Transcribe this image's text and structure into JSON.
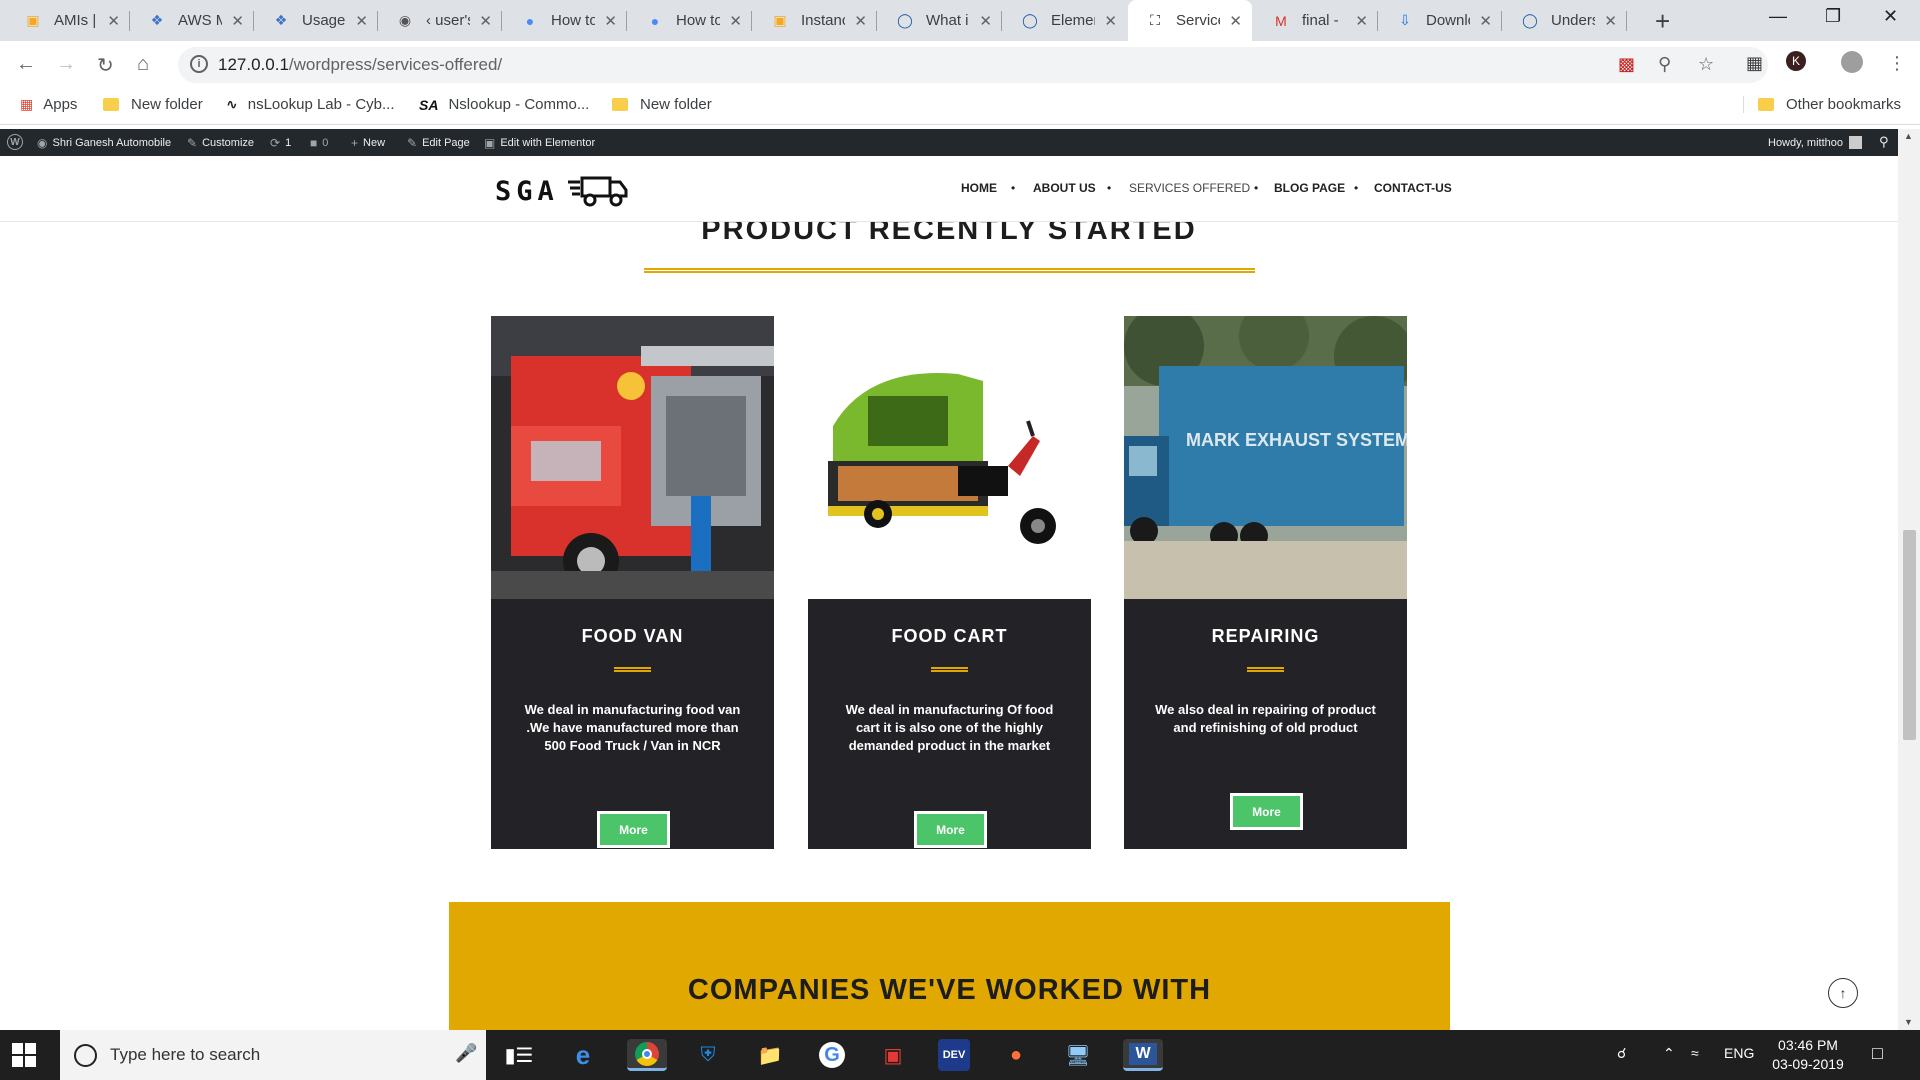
{
  "browser": {
    "tabs": [
      {
        "title": "AMIs |",
        "icon": "aws-icon",
        "color": "#f7a81b"
      },
      {
        "title": "AWS M",
        "icon": "aws-cubes-icon",
        "color": "#3b73c8"
      },
      {
        "title": "Usage",
        "icon": "aws-cubes-icon",
        "color": "#3b73c8"
      },
      {
        "title": "‹ user's",
        "icon": "globe-icon",
        "color": "#555"
      },
      {
        "title": "How to",
        "icon": "people-icon",
        "color": "#4c8bf5"
      },
      {
        "title": "How to",
        "icon": "people-icon",
        "color": "#4c8bf5"
      },
      {
        "title": "Instanc",
        "icon": "aws-icon",
        "color": "#f7a81b"
      },
      {
        "title": "What i",
        "icon": "b-icon",
        "color": "#1f5fa8"
      },
      {
        "title": "Elemen",
        "icon": "b-icon",
        "color": "#1f5fa8"
      },
      {
        "title": "Service",
        "icon": "truck-icon",
        "color": "#222",
        "active": true
      },
      {
        "title": "final -",
        "icon": "gmail-icon",
        "color": "#d93025"
      },
      {
        "title": "Downlo",
        "icon": "download-icon",
        "color": "#1a73e8"
      },
      {
        "title": "Unders",
        "icon": "b-icon",
        "color": "#1f5fa8"
      }
    ],
    "url_host": "127.0.0.1",
    "url_path": "/wordpress/services-offered/",
    "profile_letter": "K",
    "bookmarks": [
      {
        "label": "Apps",
        "type": "apps"
      },
      {
        "label": "New folder",
        "type": "folder"
      },
      {
        "label": "nsLookup Lab - Cyb...",
        "type": "site"
      },
      {
        "label": "Nslookup - Commo...",
        "type": "sa"
      },
      {
        "label": "New folder",
        "type": "folder"
      }
    ],
    "other_bookmarks": "Other bookmarks"
  },
  "adminbar": {
    "site_name": "Shri Ganesh Automobile",
    "customize": "Customize",
    "updates": "1",
    "comments": "0",
    "new": "New",
    "edit_page": "Edit Page",
    "edit_elementor": "Edit with Elementor",
    "howdy": "Howdy, mitthoo"
  },
  "site": {
    "logo_text": "SGA",
    "nav": [
      "HOME",
      "ABOUT US",
      "SERVICES OFFERED",
      "BLOG PAGE",
      "CONTACT-US"
    ],
    "active_nav": 2,
    "section_title": "PRODUCT RECENTLY STARTED",
    "cards": [
      {
        "title": "FOOD VAN",
        "desc": "We deal in manufacturing food van .We have manufactured more than 500 Food Truck / Van in NCR",
        "button": "More"
      },
      {
        "title": "FOOD CART",
        "desc": "We deal in manufacturing Of food cart it is also one of the highly demanded product in the market",
        "button": "More"
      },
      {
        "title": "REPAIRING",
        "desc": "We also deal in repairing of product and refinishing of old product",
        "button": "More"
      }
    ],
    "truck_sign": "MARK EXHAUST SYSTEMS LTD.",
    "companies_title": "COMPANIES WE'VE WORKED WITH",
    "accent_color": "#e0a800",
    "button_color": "#4cc46a"
  },
  "taskbar": {
    "search_placeholder": "Type here to search",
    "lang": "ENG",
    "time": "03:46 PM",
    "date": "03-09-2019"
  }
}
